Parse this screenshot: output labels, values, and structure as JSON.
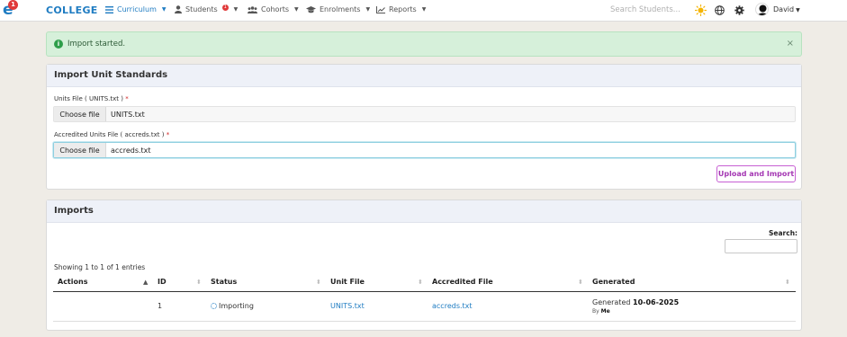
{
  "navbar": {
    "logo_letter": "e",
    "logo_badge": "1",
    "brand": "COLLEGE",
    "items": [
      {
        "label": "Curriculum",
        "icon": "list-icon"
      },
      {
        "label": "Students",
        "icon": "user-icon",
        "badge": "1"
      },
      {
        "label": "Cohorts",
        "icon": "users-icon"
      },
      {
        "label": "Enrolments",
        "icon": "graduation-cap-icon"
      },
      {
        "label": "Reports",
        "icon": "chart-line-icon"
      }
    ],
    "search_placeholder": "Search Students...",
    "user_name": "David"
  },
  "alert": {
    "icon_text": "i",
    "message": "Import started.",
    "close": "×"
  },
  "import_form": {
    "title": "Import Unit Standards",
    "units_label": "Units File ( UNITS.txt )",
    "units_button": "Choose file",
    "units_value": "UNITS.txt",
    "accreds_label": "Accredited Units File ( accreds.txt )",
    "accreds_button": "Choose file",
    "accreds_value": "accreds.txt",
    "required_mark": "*",
    "submit_label": "Upload and Import"
  },
  "imports": {
    "title": "Imports",
    "search_label": "Search:",
    "showing": "Showing 1 to 1 of 1 entries",
    "columns": [
      "Actions",
      "ID",
      "Status",
      "Unit File",
      "Accredited File",
      "Generated"
    ],
    "rows": [
      {
        "id": "1",
        "status": "Importing",
        "unit_file": "UNITS.txt",
        "accredited_file": "accreds.txt",
        "generated_prefix": "Generated",
        "generated_date": "10-06-2025",
        "by_prefix": "By",
        "by_user": "Me"
      }
    ]
  },
  "colors": {
    "brand": "#1f7cc2",
    "success_bg": "#d6f0da",
    "button_accent": "#a437b3"
  }
}
